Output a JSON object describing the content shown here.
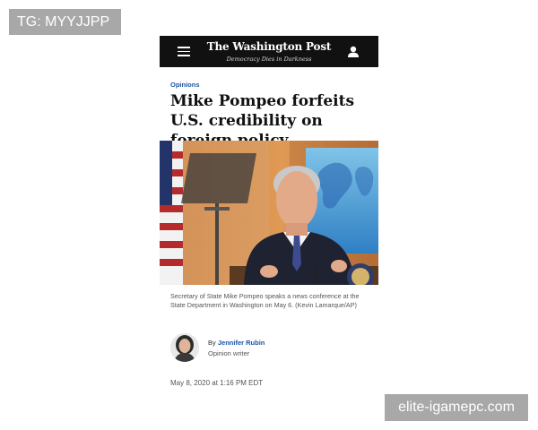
{
  "watermarks": {
    "top_left": "TG: MYYJJPP",
    "bottom_right": "elite-igamepc.com"
  },
  "header": {
    "logo": "The Washington Post",
    "tagline": "Democracy Dies in Darkness",
    "menu_icon": "hamburger-menu-icon",
    "account_icon": "user-icon"
  },
  "article": {
    "section": "Opinions",
    "headline": "Mike Pompeo forfeits U.S. credibility on foreign policy",
    "photo_caption": "Secretary of State Mike Pompeo speaks a news conference at the State Department in Washington on May 6. (Kevin Lamarque/AP)",
    "byline_prefix": "By",
    "author": "Jennifer Rubin",
    "author_role": "Opinion writer",
    "date": "May 8, 2020 at 1:16 PM EDT"
  },
  "colors": {
    "header_bg": "#111111",
    "link_blue": "#1955a5",
    "watermark_bg": "#a8a8a8"
  }
}
